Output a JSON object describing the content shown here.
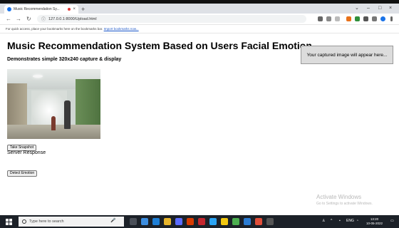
{
  "browser": {
    "tab_title": "Music Recommendation Sy...",
    "close_glyph": "×",
    "new_tab_glyph": "+",
    "window_controls": {
      "dropdown": "⌄",
      "minimize": "–",
      "maximize": "□",
      "close": "×"
    },
    "nav": {
      "back": "←",
      "forward": "→",
      "reload": "↻"
    },
    "url": "127.0.0.1:8000/Upload.html",
    "bookmarks_message": "For quick access, place your bookmarks here on the bookmarks bar.",
    "bookmarks_link": "Import bookmarks now...",
    "colors": {
      "tab_favicon": "#1a73e8",
      "recording_dot": "#e53935"
    }
  },
  "page": {
    "title": "Music Recommendation System Based on Users Facial Emotion",
    "subtitle": "Demonstrates simple 320x240 capture & display",
    "capture_placeholder": "Your captured image will appear here...",
    "take_snapshot_label": "Take Snapshot",
    "server_response_label": "Server Response",
    "detect_emotion_label": "Detect Emotion"
  },
  "watermark": {
    "line1": "Activate Windows",
    "line2": "Go to Settings to activate Windows."
  },
  "taskbar": {
    "search_placeholder": "Type here to search",
    "tray_text": "ENG",
    "time": "13:20",
    "date": "10-05-2022"
  }
}
